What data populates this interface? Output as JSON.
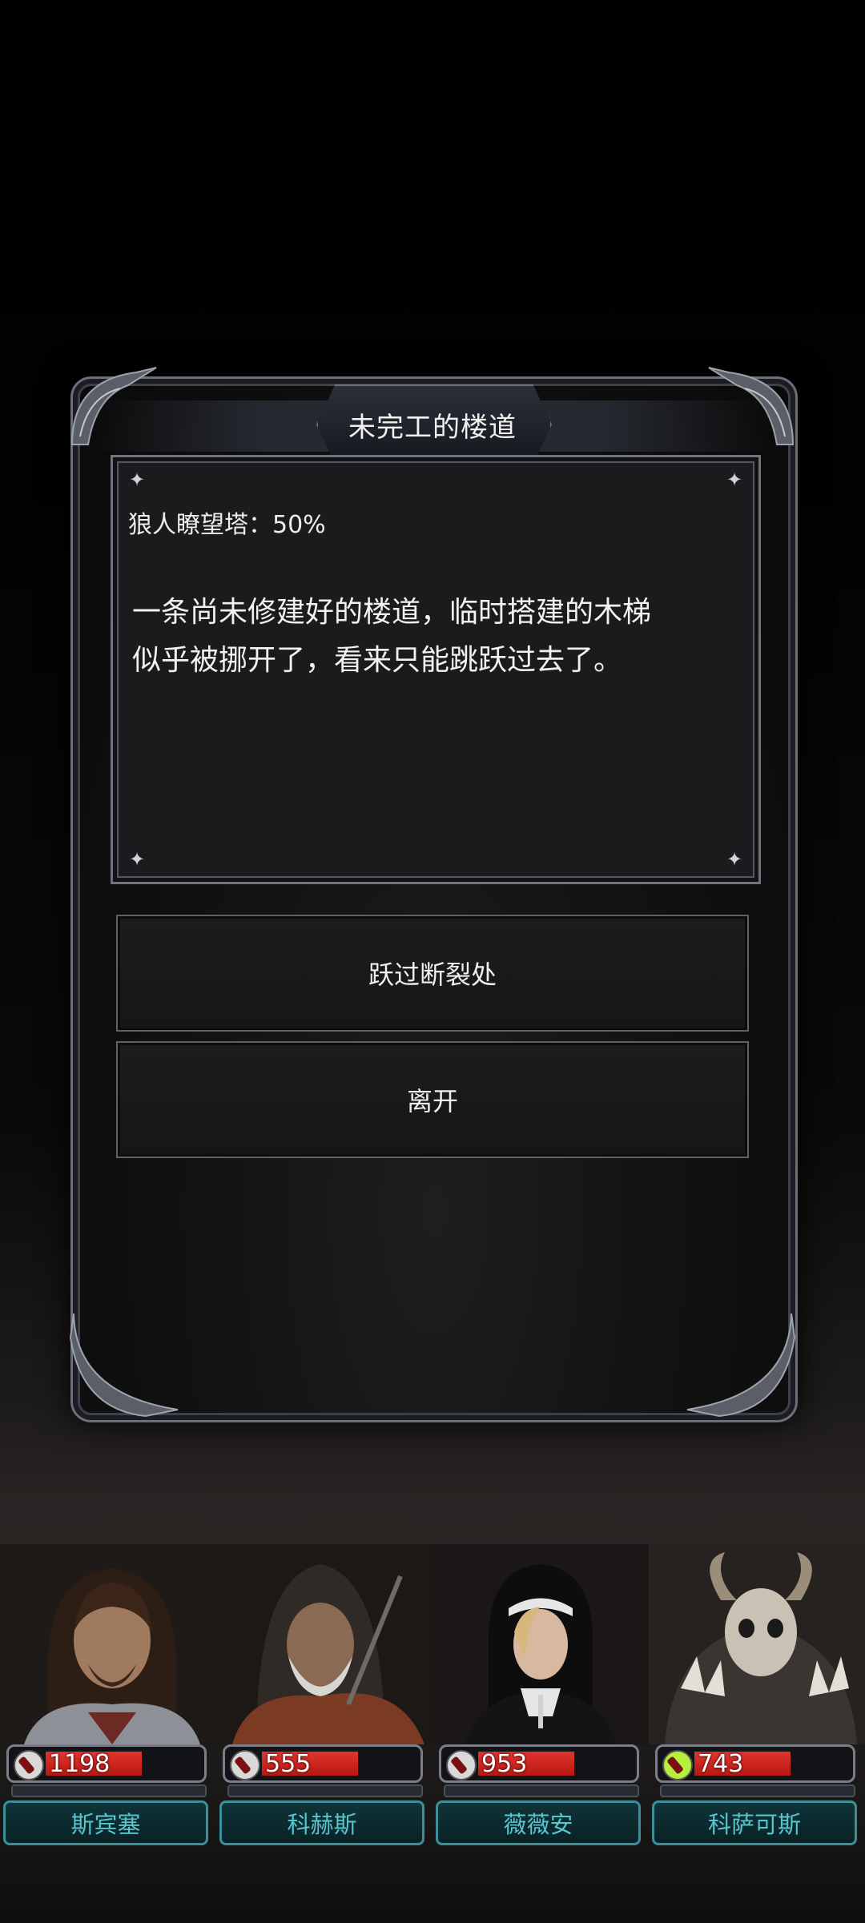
{
  "event": {
    "title": "未完工的楼道",
    "progress_label": "狼人瞭望塔：50%",
    "description_line1": "一条尚未修建好的楼道，临时搭建的木梯",
    "description_line2": "似乎被挪开了，看来只能跳跃过去了。"
  },
  "choices": [
    {
      "label": "跃过断裂处"
    },
    {
      "label": "离开"
    }
  ],
  "party": [
    {
      "name": "斯宾塞",
      "hp": "1198",
      "hp_fraction": 0.62,
      "icon": "blood-drop-icon"
    },
    {
      "name": "科赫斯",
      "hp": "555",
      "hp_fraction": 0.62,
      "icon": "blood-drop-icon"
    },
    {
      "name": "薇薇安",
      "hp": "953",
      "hp_fraction": 0.62,
      "icon": "blood-drop-icon"
    },
    {
      "name": "科萨可斯",
      "hp": "743",
      "hp_fraction": 0.62,
      "icon": "blood-drop-icon"
    }
  ],
  "colors": {
    "hp_red": "#d42a24",
    "name_teal": "#57c6cf",
    "frame_gray": "#6b6f78",
    "status_green": "#b5f03c"
  }
}
